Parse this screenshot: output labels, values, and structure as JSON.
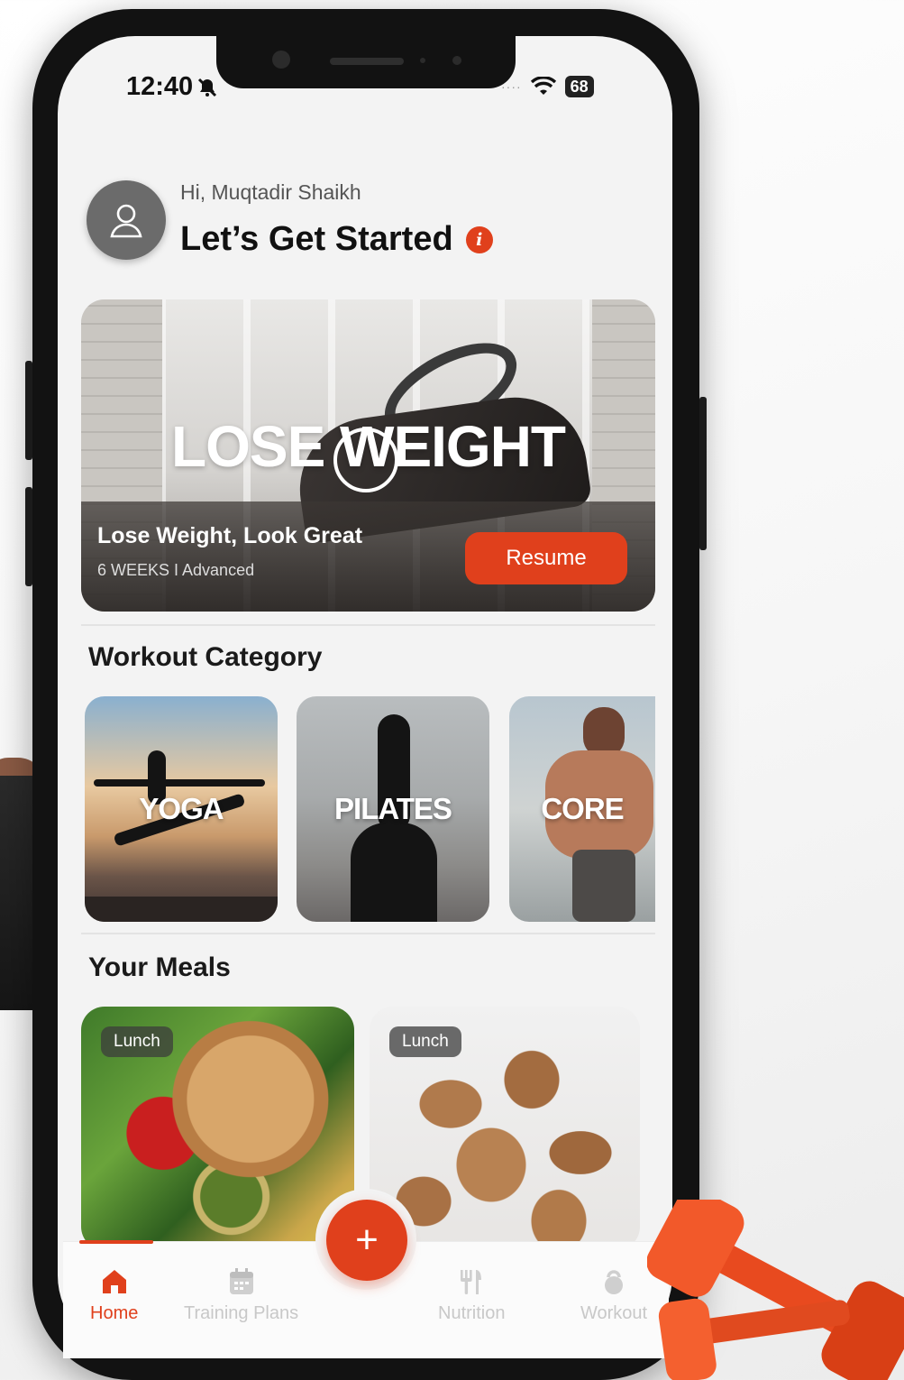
{
  "status_bar": {
    "time": "12:40",
    "battery": "68"
  },
  "header": {
    "greeting": "Hi, Muqtadir Shaikh",
    "title": "Let’s Get Started",
    "info_symbol": "i"
  },
  "hero": {
    "image_text": "LOSE WEIGHT",
    "title": "Lose Weight, Look Great",
    "meta": "6 WEEKS   I Advanced",
    "button_label": "Resume"
  },
  "workout_category": {
    "title": "Workout Category",
    "items": [
      {
        "label": "YOGA"
      },
      {
        "label": "PILATES"
      },
      {
        "label": "CORE"
      }
    ]
  },
  "meals": {
    "title": "Your Meals",
    "items": [
      {
        "tag": "Lunch"
      },
      {
        "tag": "Lunch"
      }
    ]
  },
  "bottom_nav": {
    "fab_symbol": "+",
    "items": [
      {
        "label": "Home",
        "icon": "home-icon",
        "active": true
      },
      {
        "label": "Training Plans",
        "icon": "calendar-icon",
        "active": false
      },
      {
        "label": "Nutrition",
        "icon": "utensils-icon",
        "active": false
      },
      {
        "label": "Workout",
        "icon": "kettlebell-icon",
        "active": false
      }
    ]
  },
  "colors": {
    "accent": "#e0401c",
    "background": "#f3f3f3",
    "text": "#111111"
  }
}
